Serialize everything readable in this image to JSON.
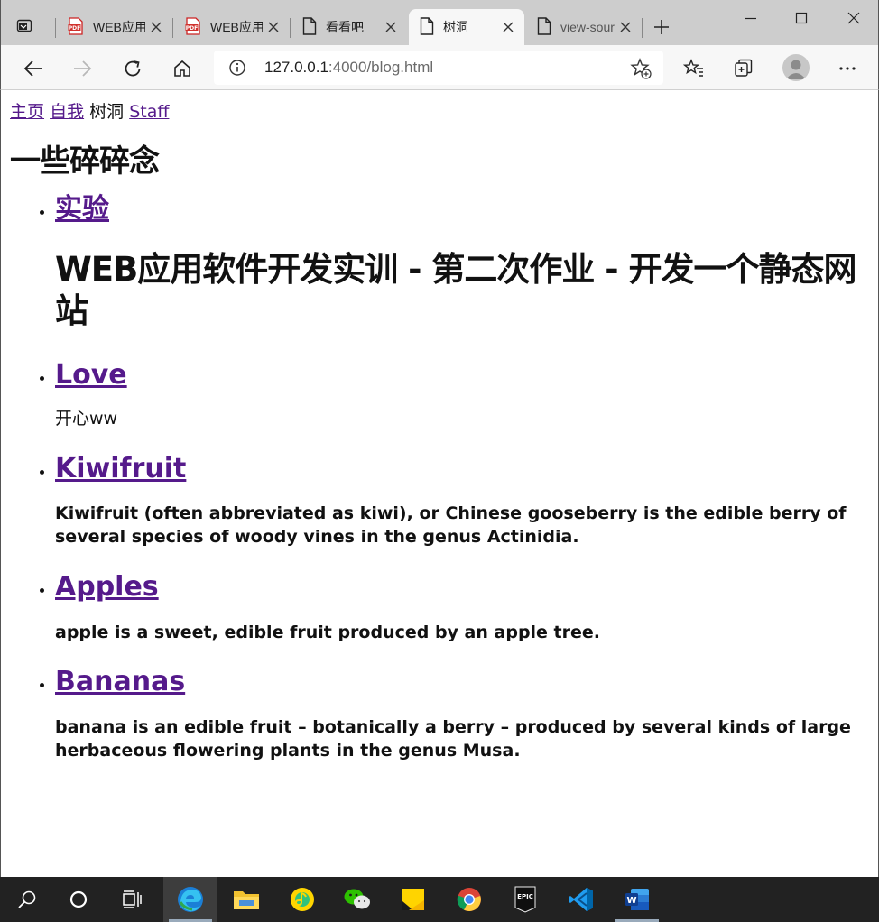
{
  "browser": {
    "tabs": [
      {
        "title": "WEB应用软件开发实训",
        "icon": "pdf-icon",
        "active": false
      },
      {
        "title": "WEB应用软件开发实训",
        "icon": "pdf-icon",
        "active": false
      },
      {
        "title": "看看吧",
        "icon": "page-icon",
        "active": false
      },
      {
        "title": "树洞",
        "icon": "page-icon",
        "active": true
      },
      {
        "title": "view-source",
        "icon": "page-icon",
        "active": false
      }
    ],
    "address": {
      "host": "127.0.0.1",
      "path": ":4000/blog.html"
    }
  },
  "page": {
    "nav": {
      "home": "主页",
      "self": "自我",
      "current": "树洞",
      "staff": "Staff"
    },
    "title": "一些碎碎念",
    "posts": [
      {
        "title": "实验",
        "excerpt": "WEB应用软件开发实训 - 第二次作业 - 开发一个静态网站"
      },
      {
        "title": "Love",
        "excerpt": "开心ww"
      },
      {
        "title": "Kiwifruit",
        "excerpt": "Kiwifruit (often abbreviated as kiwi), or Chinese gooseberry is the edible berry of several species of woody vines in the genus Actinidia."
      },
      {
        "title": "Apples",
        "excerpt": "apple is a sweet, edible fruit produced by an apple tree."
      },
      {
        "title": "Bananas",
        "excerpt": "banana is an edible fruit – botanically a berry – produced by several kinds of large herbaceous flowering plants in the genus Musa."
      }
    ]
  },
  "taskbar": {
    "items": [
      "search-icon",
      "cortana-icon",
      "task-view-icon",
      "edge-icon",
      "file-explorer-icon",
      "qq-music-icon",
      "wechat-icon",
      "sticky-notes-icon",
      "chrome-icon",
      "epic-games-icon",
      "vscode-icon",
      "word-icon"
    ],
    "epic_label": "EPIC",
    "word_label": "W"
  }
}
